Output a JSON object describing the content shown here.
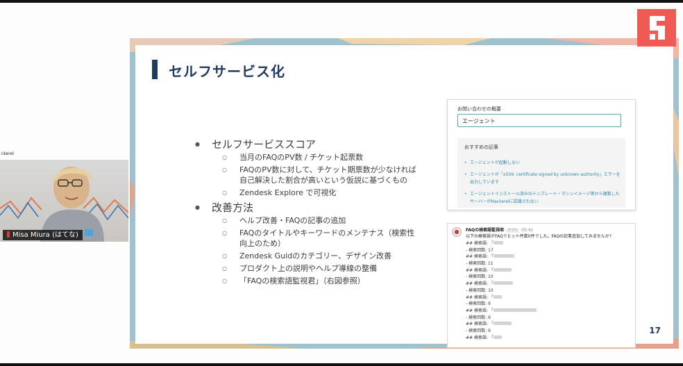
{
  "presenter": {
    "name": "Misa Miura (はてな)",
    "side_label": "ckerel"
  },
  "slide": {
    "title": "セルフサービス化",
    "page_number": "17",
    "sections": [
      {
        "heading": "セルフサービススコア",
        "items": [
          "当月のFAQのPV数 / チケット起票数",
          "FAQのPV数に対して、チケット期票数が少なければ自己解決した割合が高いという仮説に基づくもの",
          "Zendesk Explore で可視化"
        ]
      },
      {
        "heading": "改善方法",
        "items": [
          "ヘルプ改善・FAQの記事の追加",
          "FAQのタイトルやキーワードのメンテナス（検索性向上のため）",
          "Zendesk Guidのカテゴリー、デザイン改善",
          "プロダクト上の説明やヘルプ導線の整備",
          "「FAQの検索語監視君」（右図参照）"
        ]
      }
    ]
  },
  "form_screenshot": {
    "field_label": "お問い合わせの概要",
    "field_value": "エージェント",
    "recommend_heading": "おすすめの記事",
    "articles": [
      "エージェントが起動しない",
      "エージェントが「x509: certificate signed by unknown authority」エラーを出力しています",
      "エージェントインストール済みのテンプレート・マシンイメージ等から複製したサーバーがMackerelに認識されない"
    ]
  },
  "chat_screenshot": {
    "bot_name": "FAQの検索語監視君",
    "app_tag": "アプリ",
    "time": "05:41",
    "message": "以下の検索語がFAQでヒット件数0件でした。FAQの記事追加してみませんか?",
    "lines": [
      {
        "label": "## 検索語: 「",
        "count_label": null
      },
      {
        "label": "- 検索回数: 17"
      },
      {
        "label": "## 検索語: 「"
      },
      {
        "label": "- 検索回数: 11"
      },
      {
        "label": "## 検索語: 「"
      },
      {
        "label": "- 検索回数: 10"
      },
      {
        "label": "## 検索語: 「"
      },
      {
        "label": "- 検索回数: 10"
      },
      {
        "label": "## 検索語: 「"
      },
      {
        "label": "- 検索回数: 9"
      },
      {
        "label": "## 検索語: 「"
      },
      {
        "label": "- 検索回数: 9"
      },
      {
        "label": "## 検索語: 「"
      },
      {
        "label": "- 検索回数: 9"
      },
      {
        "label": "## 検索語: 「"
      }
    ]
  },
  "colors": {
    "title": "#1f3b63",
    "logo": "#f05a54",
    "link": "#2c87a8"
  },
  "icons": {
    "logo": "hatena-logo-icon",
    "avatar": "bot-avatar-icon"
  }
}
